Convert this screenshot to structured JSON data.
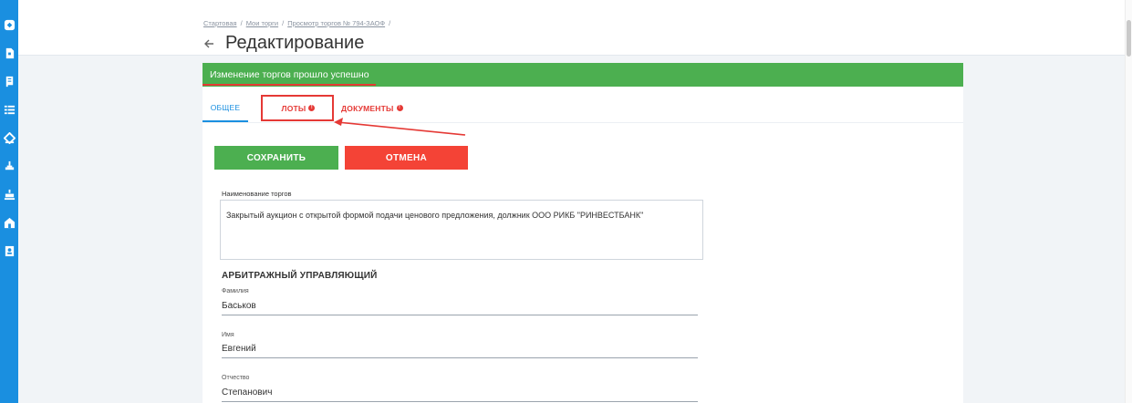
{
  "breadcrumb": {
    "home": "Стартовая",
    "sep1": "/",
    "my_trades": "Мои торги",
    "sep2": "/",
    "view": "Просмотр торгов № 794-ЗАОФ",
    "sep3": "/"
  },
  "page": {
    "title": "Редактирование"
  },
  "alert": {
    "text": "Изменение торгов прошло успешно",
    "color": "#4caf50"
  },
  "tabs": {
    "general": "ОБЩЕЕ",
    "lots": "ЛОТЫ",
    "documents": "ДОКУМЕНТЫ",
    "error_mark": "!"
  },
  "buttons": {
    "save": "СОХРАНИТЬ",
    "cancel": "ОТМЕНА"
  },
  "form": {
    "trade_name_label": "Наименование торгов",
    "trade_name_value": "Закрытый аукцион с открытой формой подачи ценового предложения, должник ООО РИКБ \"РИНВЕСТБАНК\"",
    "manager_section": "АРБИТРАЖНЫЙ УПРАВЛЯЮЩИЙ",
    "last_name_label": "Фамилия",
    "last_name_value": "Баськов",
    "first_name_label": "Имя",
    "first_name_value": "Евгений",
    "patronymic_label": "Отчество",
    "patronymic_value": "Степанович"
  },
  "sidebar": {
    "icons": [
      "home-icon",
      "document-icon",
      "scroll-icon",
      "list-icon",
      "handshake-icon",
      "auction-icon",
      "gavel-icon",
      "building-icon",
      "contacts-icon"
    ]
  },
  "colors": {
    "accent": "#1a8fe0",
    "error": "#e53935",
    "success": "#4caf50"
  }
}
